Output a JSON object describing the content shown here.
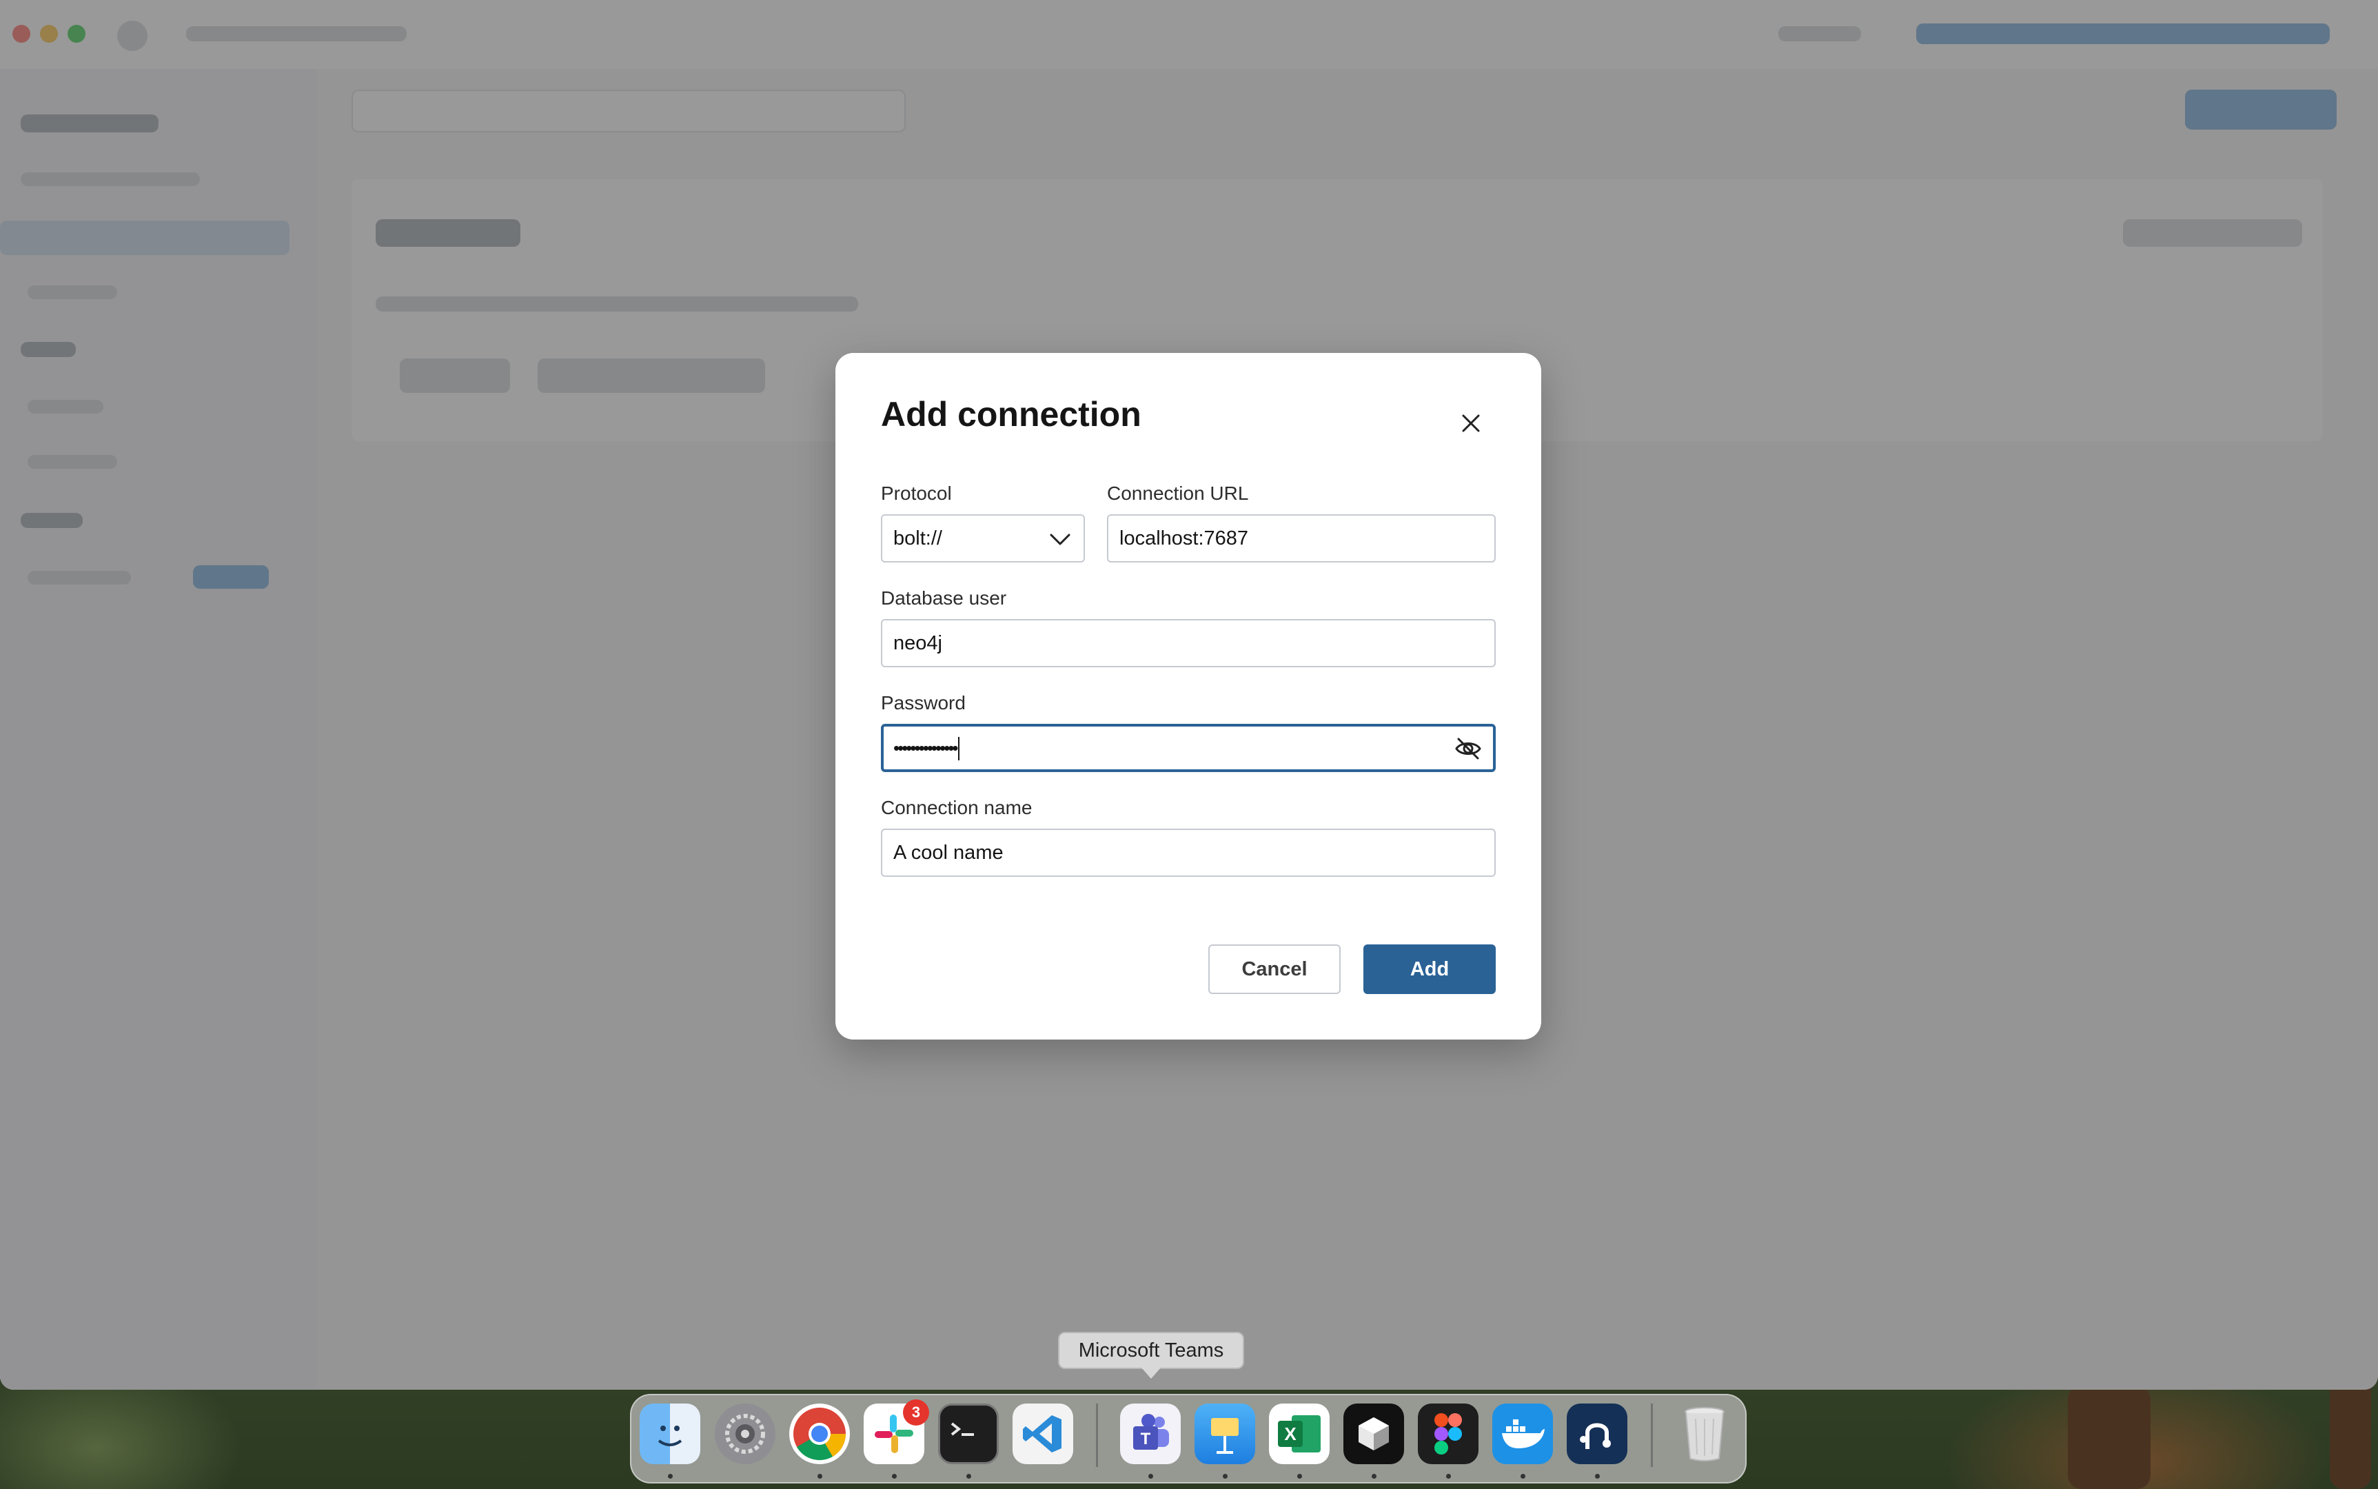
{
  "dialog": {
    "title": "Add connection",
    "protocol": {
      "label": "Protocol",
      "value": "bolt://"
    },
    "connection_url": {
      "label": "Connection URL",
      "value": "localhost:7687"
    },
    "database_user": {
      "label": "Database user",
      "value": "neo4j"
    },
    "password": {
      "label": "Password",
      "value": "•••••••••••••••"
    },
    "connection_name": {
      "label": "Connection name",
      "value": "A cool name"
    },
    "cancel_label": "Cancel",
    "add_label": "Add"
  },
  "tooltip": {
    "text": "Microsoft Teams"
  },
  "dock": {
    "apps": [
      {
        "name": "Finder",
        "icon": "finder-icon"
      },
      {
        "name": "System Settings",
        "icon": "settings-icon"
      },
      {
        "name": "Google Chrome",
        "icon": "chrome-icon"
      },
      {
        "name": "Slack",
        "icon": "slack-icon",
        "badge": "3"
      },
      {
        "name": "Terminal",
        "icon": "terminal-icon"
      },
      {
        "name": "Visual Studio Code",
        "icon": "vscode-icon"
      },
      {
        "name": "Microsoft Teams",
        "icon": "teams-icon"
      },
      {
        "name": "Keynote",
        "icon": "keynote-icon"
      },
      {
        "name": "Microsoft Excel",
        "icon": "excel-icon"
      },
      {
        "name": "Cursor",
        "icon": "cube-icon"
      },
      {
        "name": "Figma",
        "icon": "figma-icon"
      },
      {
        "name": "Docker",
        "icon": "docker-icon"
      },
      {
        "name": "Neo4j Desktop",
        "icon": "neo4j-icon"
      },
      {
        "name": "Trash",
        "icon": "trash-icon"
      }
    ]
  },
  "colors": {
    "accent": "#2a6296",
    "badge": "#e5342c"
  }
}
